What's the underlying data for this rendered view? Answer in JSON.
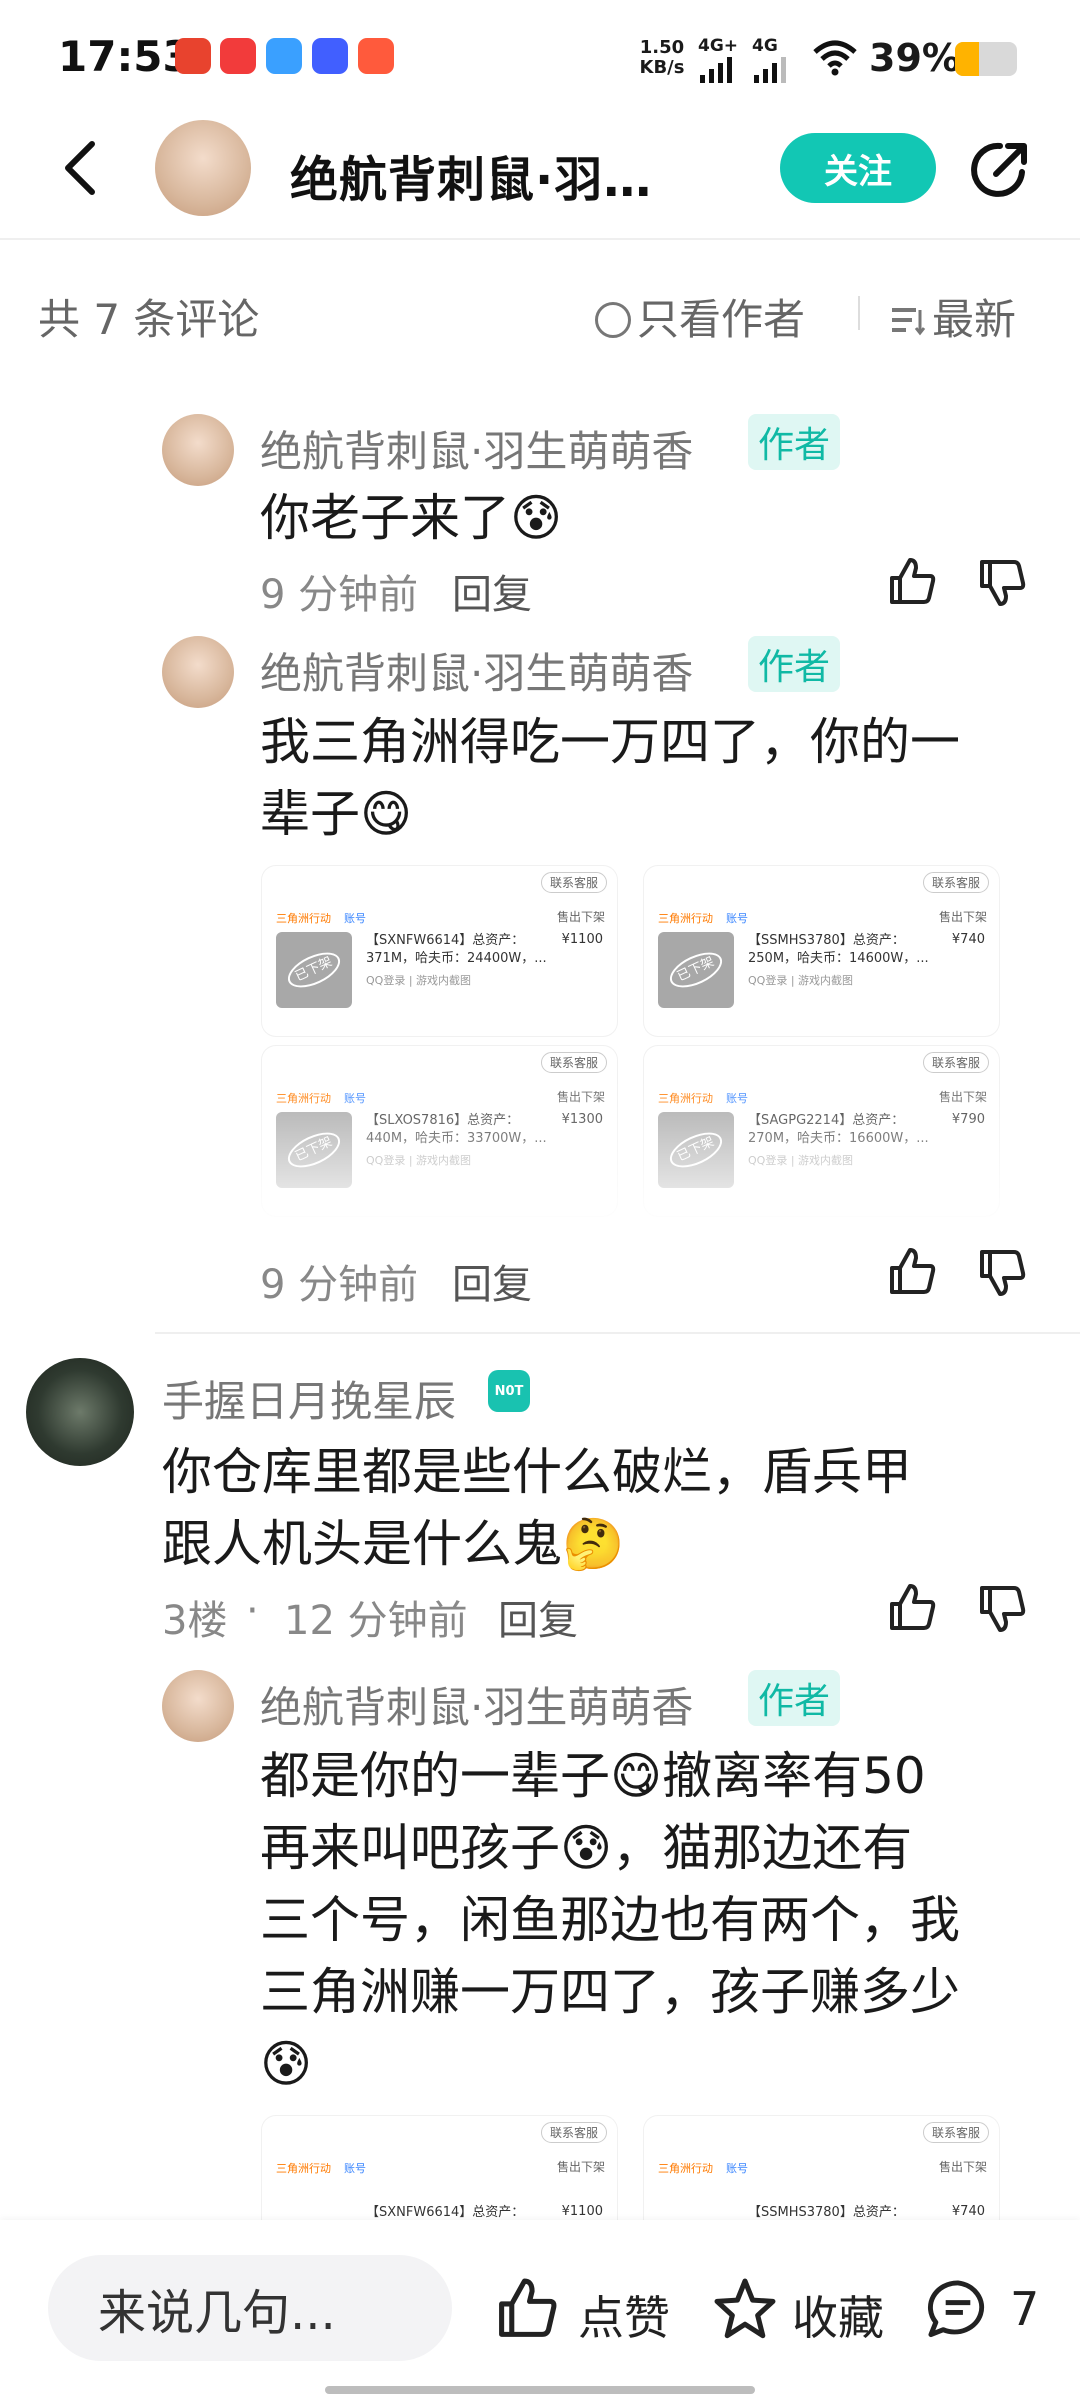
{
  "status_bar": {
    "time": "17:53",
    "net_speed_value": "1.50",
    "net_speed_unit": "KB/s",
    "signal1": "4G+",
    "signal2": "4G",
    "battery": "39%",
    "battery_level": 0.39,
    "app_icons": [
      "red-app-icon",
      "video-app-icon",
      "blue-app-icon",
      "vivo-app-icon",
      "game-app-icon"
    ]
  },
  "nav": {
    "title": "绝航背刺鼠·羽…",
    "follow_label": "关注"
  },
  "filter": {
    "count_label": "共 7 条评论",
    "author_only_label": "只看作者",
    "sort_label": "最新"
  },
  "comments": [
    {
      "user": "绝航背刺鼠·羽生萌萌香",
      "badge": "作者",
      "text": "你老子来了😰",
      "time": "9 分钟前",
      "reply": "回复"
    },
    {
      "user": "绝航背刺鼠·羽生萌萌香",
      "badge": "作者",
      "text_line1": "我三角洲得吃一万四了，你的一",
      "text_line2": "辈子😋",
      "time": "9 分钟前",
      "reply": "回复"
    },
    {
      "user": "手握日月挽星辰",
      "badge": "N0T",
      "text_line1": "你仓库里都是些什么破烂，盾兵甲",
      "text_line2": "跟人机头是什么鬼🤔",
      "floor": "3楼",
      "time": "12 分钟前",
      "reply": "回复"
    },
    {
      "user": "绝航背刺鼠·羽生萌萌香",
      "badge": "作者",
      "text_line1": "都是你的一辈子😋撤离率有50",
      "text_line2": "再来叫吧孩子😰，猫那边还有",
      "text_line3": "三个号，闲鱼那边也有两个，我",
      "text_line4": "三角洲赚一万四了，孩子赚多少",
      "text_line5": "😰"
    }
  ],
  "listing_cards": [
    {
      "service": "联系客服",
      "game_tag": "三角洲行动",
      "type_tag": "账号",
      "status": "售出下架",
      "desc": "【SXNFW6614】总资产：371M，哈夫币：24400W，...",
      "price": "¥1100",
      "sub": "QQ登录 | 游戏内截图",
      "stamp": "已下架"
    },
    {
      "service": "联系客服",
      "game_tag": "三角洲行动",
      "type_tag": "账号",
      "status": "售出下架",
      "desc": "【SSMHS3780】总资产：250M，哈夫币：14600W，...",
      "price": "¥740",
      "sub": "QQ登录 | 游戏内截图",
      "stamp": "已下架"
    },
    {
      "service": "联系客服",
      "game_tag": "三角洲行动",
      "type_tag": "账号",
      "status": "售出下架",
      "desc": "【SLXOS7816】总资产：440M，哈夫币：33700W，...",
      "price": "¥1300",
      "sub": "QQ登录 | 游戏内截图",
      "stamp": "已下架"
    },
    {
      "service": "联系客服",
      "game_tag": "三角洲行动",
      "type_tag": "账号",
      "status": "售出下架",
      "desc": "【SAGPG2214】总资产：270M，哈夫币：16600W，...",
      "price": "¥790",
      "sub": "QQ登录 | 游戏内截图",
      "stamp": "已下架"
    },
    {
      "service": "联系客服",
      "game_tag": "三角洲行动",
      "type_tag": "账号",
      "status": "售出下架",
      "desc": "【SXNFW6614】总资产：",
      "price": "¥1100",
      "sub": "",
      "stamp": ""
    },
    {
      "service": "联系客服",
      "game_tag": "三角洲行动",
      "type_tag": "账号",
      "status": "售出下架",
      "desc": "【SSMHS3780】总资产：",
      "price": "¥740",
      "sub": "",
      "stamp": ""
    }
  ],
  "bottom_bar": {
    "input_placeholder": "来说几句...",
    "like_label": "点赞",
    "fav_label": "收藏",
    "comment_count": "7"
  },
  "colors": {
    "accent": "#12c7b4",
    "badge_bg": "#dff7f3",
    "badge_text": "#10b9a5"
  }
}
